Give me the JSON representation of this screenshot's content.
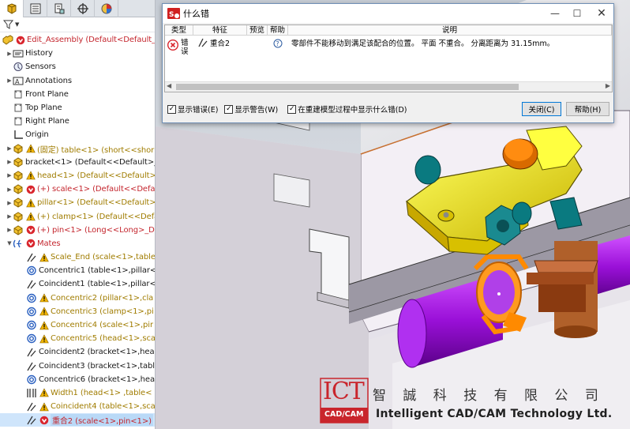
{
  "tree": {
    "rows": [
      {
        "label": "Edit_Assembly  (Default<Default_D",
        "style": "red",
        "icon": "assembly-icon",
        "badge": "error-badge",
        "expander": "",
        "indent": 0
      },
      {
        "label": "History",
        "style": "",
        "icon": "history-folder-icon",
        "badge": "",
        "expander": "▶",
        "indent": 1
      },
      {
        "label": "Sensors",
        "style": "",
        "icon": "sensors-icon",
        "badge": "",
        "expander": "",
        "indent": 1
      },
      {
        "label": "Annotations",
        "style": "",
        "icon": "annotations-icon",
        "badge": "",
        "expander": "▶",
        "indent": 1
      },
      {
        "label": "Front Plane",
        "style": "",
        "icon": "plane-icon",
        "badge": "",
        "expander": "",
        "indent": 1
      },
      {
        "label": "Top Plane",
        "style": "",
        "icon": "plane-icon",
        "badge": "",
        "expander": "",
        "indent": 1
      },
      {
        "label": "Right Plane",
        "style": "",
        "icon": "plane-icon",
        "badge": "",
        "expander": "",
        "indent": 1
      },
      {
        "label": "Origin",
        "style": "",
        "icon": "origin-icon",
        "badge": "",
        "expander": "",
        "indent": 1
      },
      {
        "label": "(固定) table<1> (short<<shor",
        "style": "warn",
        "icon": "part-icon",
        "badge": "warning-badge",
        "expander": "▶",
        "indent": 1
      },
      {
        "label": "bracket<1> (Default<<Default>_D",
        "style": "",
        "icon": "part-icon",
        "badge": "",
        "expander": "▶",
        "indent": 1
      },
      {
        "label": "head<1> (Default<<Default>_",
        "style": "warn",
        "icon": "part-icon",
        "badge": "warning-badge",
        "expander": "▶",
        "indent": 1
      },
      {
        "label": "(+) scale<1> (Default<<Defau",
        "style": "red",
        "icon": "part-icon",
        "badge": "error-badge",
        "expander": "▶",
        "indent": 1
      },
      {
        "label": "pillar<1> (Default<<Default>_",
        "style": "warn",
        "icon": "part-icon",
        "badge": "warning-badge",
        "expander": "▶",
        "indent": 1
      },
      {
        "label": "(+) clamp<1> (Default<<Defa",
        "style": "warn",
        "icon": "part-icon",
        "badge": "warning-badge",
        "expander": "▶",
        "indent": 1
      },
      {
        "label": "(+) pin<1> (Long<<Long>_D",
        "style": "red",
        "icon": "part-icon",
        "badge": "error-badge",
        "expander": "▶",
        "indent": 1
      },
      {
        "label": "Mates",
        "style": "red",
        "icon": "mates-folder-icon",
        "badge": "error-badge",
        "expander": "▼",
        "indent": 1
      },
      {
        "label": "Scale_End (scale<1>,table",
        "style": "warn",
        "icon": "coincident-mate-icon",
        "badge": "warning-badge",
        "expander": "",
        "indent": 2
      },
      {
        "label": "Concentric1 (table<1>,pillar<",
        "style": "",
        "icon": "concentric-mate-icon",
        "badge": "",
        "expander": "",
        "indent": 2
      },
      {
        "label": "Coincident1 (table<1>,pillar<",
        "style": "",
        "icon": "coincident-mate-icon",
        "badge": "",
        "expander": "",
        "indent": 2
      },
      {
        "label": "Concentric2 (pillar<1>,cla",
        "style": "warn",
        "icon": "concentric-mate-icon",
        "badge": "warning-badge",
        "expander": "",
        "indent": 2
      },
      {
        "label": "Concentric3 (clamp<1>,pi",
        "style": "warn",
        "icon": "concentric-mate-icon",
        "badge": "warning-badge",
        "expander": "",
        "indent": 2
      },
      {
        "label": "Concentric4 (scale<1>,pir",
        "style": "warn",
        "icon": "concentric-mate-icon",
        "badge": "warning-badge",
        "expander": "",
        "indent": 2
      },
      {
        "label": "Concentric5 (head<1>,sca",
        "style": "warn",
        "icon": "concentric-mate-icon",
        "badge": "warning-badge",
        "expander": "",
        "indent": 2
      },
      {
        "label": "Coincident2 (bracket<1>,head",
        "style": "",
        "icon": "coincident-mate-icon",
        "badge": "",
        "expander": "",
        "indent": 2
      },
      {
        "label": "Coincident3 (bracket<1>,table",
        "style": "",
        "icon": "coincident-mate-icon",
        "badge": "",
        "expander": "",
        "indent": 2
      },
      {
        "label": "Concentric6 (bracket<1>,head",
        "style": "",
        "icon": "concentric-mate-icon",
        "badge": "",
        "expander": "",
        "indent": 2
      },
      {
        "label": "Width1 (head<1> ,table<",
        "style": "warn",
        "icon": "width-mate-icon",
        "badge": "warning-badge",
        "expander": "",
        "indent": 2
      },
      {
        "label": "Coincident4 (table<1>,sca",
        "style": "warn",
        "icon": "coincident-mate-icon",
        "badge": "warning-badge",
        "expander": "",
        "indent": 2
      },
      {
        "label": "重合2 (scale<1>,pin<1>)",
        "style": "sel",
        "icon": "coincident-mate-icon",
        "badge": "error-badge",
        "expander": "",
        "indent": 2
      }
    ]
  },
  "dialog": {
    "title": "什么错",
    "columns": {
      "type": "类型",
      "feature": "特征",
      "preview": "预览",
      "help": "帮助",
      "description": "说明"
    },
    "row": {
      "type_line1": "错",
      "type_line2": "误",
      "feature": "重合2",
      "description": "零部件不能移动到满足该配合的位置。 平面 不重合。 分离距离为 31.15mm。"
    },
    "options": {
      "show_errors": "显示错误(E)",
      "show_warnings": "显示警告(W)",
      "show_during_rebuild": "在重建模型过程中显示什么错(D)"
    },
    "buttons": {
      "close": "关闭(C)",
      "help": "帮助(H)"
    }
  },
  "watermark": {
    "logo_text": "ICT",
    "logo_sub": "CAD/CAM",
    "company_cn": "智 誠 科 技 有 限 公 司",
    "company_en": "Intelligent CAD/CAM Technology Ltd."
  },
  "colors": {
    "error": "#d9262e",
    "warning": "#f0b400",
    "selection": "#b9d9f7",
    "accent": "#0078d7"
  }
}
